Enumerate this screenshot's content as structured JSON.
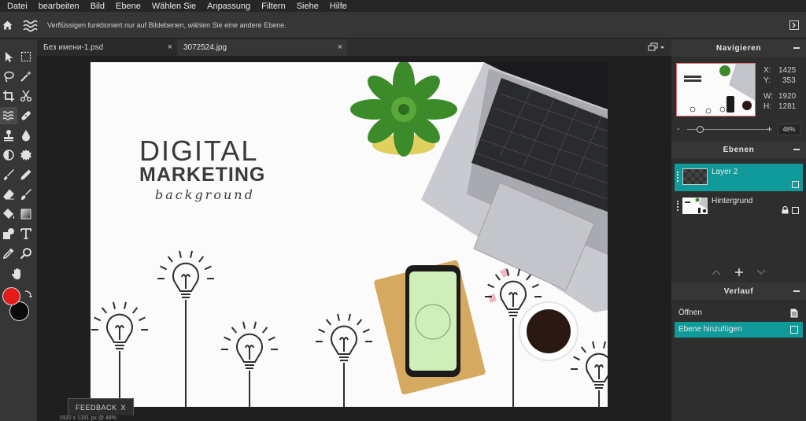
{
  "menu": [
    "Datei",
    "bearbeiten",
    "Bild",
    "Ebene",
    "Wählen Sie",
    "Anpassung",
    "Filtern",
    "Siehe",
    "Hilfe"
  ],
  "options_bar": {
    "message": "Verflüssigen funktioniert nur auf Bildebenen, wählen Sie eine andere Ebene."
  },
  "tabs": [
    {
      "label": "Без имени-1.psd",
      "close": "×"
    },
    {
      "label": "3072524.jpg",
      "close": "×"
    }
  ],
  "colors": {
    "foreground": "#e21b1b",
    "background": "#0a0a0a",
    "accent": "#119a9a"
  },
  "canvas": {
    "headline_1": "DIGITAL",
    "headline_2": "MARKETING",
    "headline_3": "background"
  },
  "status": "1920 x 1281 px @ 48%",
  "feedback": {
    "label": "FEEDBACK",
    "close": "X"
  },
  "navigator": {
    "title": "Navigieren",
    "x_label": "X:",
    "x": "1425",
    "y_label": "Y:",
    "y": "353",
    "w_label": "W:",
    "w": "1920",
    "h_label": "H:",
    "h": "1281",
    "zoom_minus": "-",
    "zoom_plus": "+",
    "zoom": "48%",
    "zoom_level": 0.16
  },
  "layers": {
    "title": "Ebenen",
    "items": [
      {
        "name": "Layer 2",
        "selected": true
      },
      {
        "name": "Hintergrund",
        "selected": false
      }
    ]
  },
  "history": {
    "title": "Verlauf",
    "items": [
      {
        "label": "Öffnen",
        "selected": false
      },
      {
        "label": "Ebene hinzufügen",
        "selected": true
      }
    ]
  }
}
